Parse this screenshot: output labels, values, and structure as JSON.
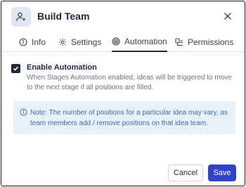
{
  "dialog": {
    "title": "Build Team"
  },
  "tabs": [
    {
      "label": "Info",
      "icon": "info-icon"
    },
    {
      "label": "Settings",
      "icon": "gear-icon"
    },
    {
      "label": "Automation",
      "icon": "automation-icon",
      "active": true
    },
    {
      "label": "Permissions",
      "icon": "permissions-icon"
    }
  ],
  "automation": {
    "checkbox_label": "Enable Automation",
    "checked": true,
    "description": "When Stages Automation enabled, ideas will be triggered to move to the next stage if all positions are filled."
  },
  "note": {
    "text": "Note: The number of positions for a particular idea may vary, as team members add / remove positions on that idea team."
  },
  "buttons": {
    "cancel_label": "Cancel",
    "save_label": "Save"
  },
  "colors": {
    "primary": "#2f44c6",
    "note_bg": "#e8f0f9",
    "note_text": "#3b6ea8",
    "avatar_bg": "#e0e7f4"
  }
}
